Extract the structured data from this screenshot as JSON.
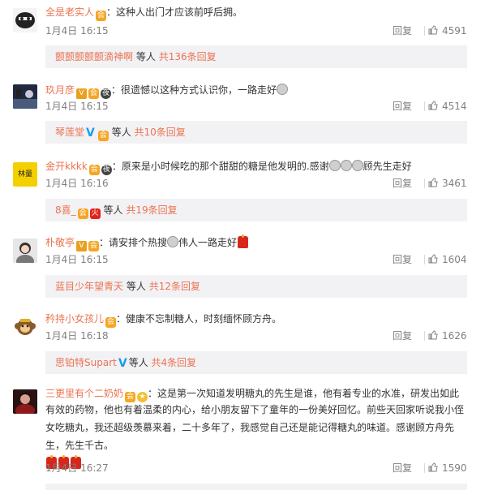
{
  "comments": [
    {
      "user": "全是老实人",
      "text": "这种人出门才应该前呼后拥。",
      "time": "1月4日 16:15",
      "reply": "回复",
      "likes": "4591",
      "sub": {
        "names": "颤颤颤颤颤滴神啊",
        "mid": "等人",
        "count": "共136条回复"
      }
    },
    {
      "user": "玖月彦",
      "text": "很遗憾以这种方式认识你，一路走好",
      "time": "1月4日 16:15",
      "reply": "回复",
      "likes": "4514",
      "sub": {
        "names": "琴莲堂",
        "mid": "等人",
        "count": "共10条回复"
      }
    },
    {
      "user": "金开kkkk",
      "text": "原来是小时候吃的那个甜甜的糖是他发明的.感谢",
      "text_tail": "顾先生走好",
      "time": "1月4日 16:16",
      "reply": "回复",
      "likes": "3461",
      "avatar_text": "林量",
      "sub": {
        "names": "8喜_",
        "mid": "等人",
        "count": "共19条回复"
      }
    },
    {
      "user": "朴敬亭",
      "text": "请安排个热搜",
      "text_tail": "伟人一路走好",
      "time": "1月4日 16:15",
      "reply": "回复",
      "likes": "1604",
      "sub": {
        "names": "蓝目少年望青天",
        "mid": "等人",
        "count": "共12条回复"
      }
    },
    {
      "user": "矜持小女孩儿",
      "text": "健康不忘制糖人，时刻缅怀顾方舟。",
      "time": "1月4日 16:18",
      "reply": "回复",
      "likes": "1626",
      "sub": {
        "names": "思铂特Supart",
        "mid": "等人",
        "count": "共4条回复"
      }
    },
    {
      "user": "三更里有个二奶奶",
      "line1": "这是第一次知道发明糖丸的先生是谁，他有着专业的水准，研发出如此",
      "line2": "有效的药物，他也有着温柔的内心，给小朋友留下了童年的一份美好回忆。前些天回家听说我小侄",
      "line3": "女吃糖丸，我还超级羡慕来着，二十多年了，我感觉自己还是能记得糖丸的味道。感谢顾方舟先",
      "line4": "生，先生千古。",
      "time": "1月4日 16:27",
      "reply": "回复",
      "likes": "1590"
    }
  ],
  "colors": {
    "username": "#eb7350",
    "meta": "#808080",
    "subbox": "#f2f2f5",
    "verified": "#1a9cef"
  }
}
